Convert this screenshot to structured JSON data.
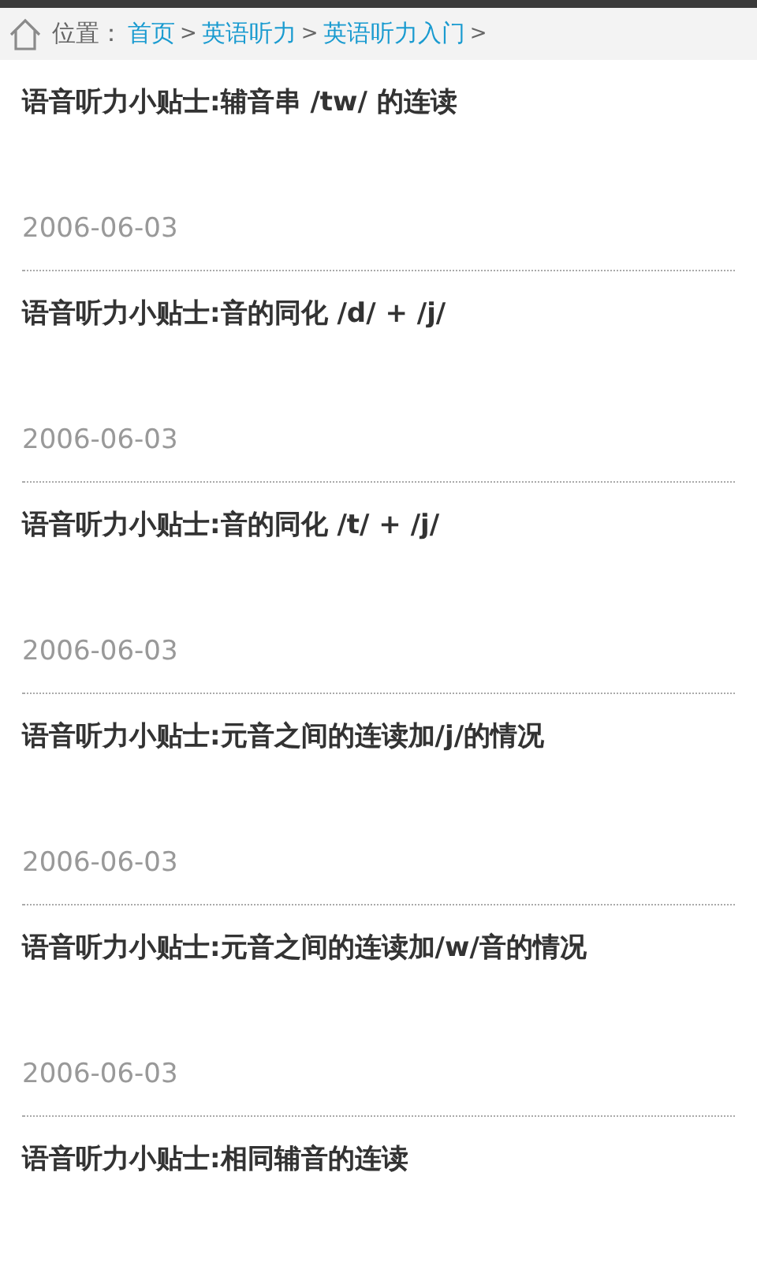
{
  "breadcrumb": {
    "label": "位置：",
    "links": [
      "首页",
      "英语听力",
      "英语听力入门"
    ],
    "separator": ">"
  },
  "articles": [
    {
      "title": "语音听力小贴士:辅音串 /tw/ 的连读",
      "date": "2006-06-03"
    },
    {
      "title": "语音听力小贴士:音的同化 /d/ + /j/",
      "date": "2006-06-03"
    },
    {
      "title": "语音听力小贴士:音的同化 /t/ + /j/",
      "date": "2006-06-03"
    },
    {
      "title": "语音听力小贴士:元音之间的连读加/j/的情况",
      "date": "2006-06-03"
    },
    {
      "title": "语音听力小贴士:元音之间的连读加/w/音的情况",
      "date": "2006-06-03"
    },
    {
      "title": "语音听力小贴士:相同辅音的连读"
    }
  ]
}
